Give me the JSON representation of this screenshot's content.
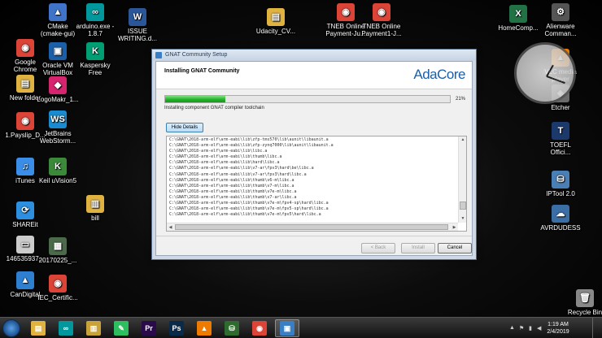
{
  "desktop": {
    "icons": [
      {
        "label": "Google\nChrome",
        "glyph": "◉",
        "color": "#db4437"
      },
      {
        "label": "New folder",
        "glyph": "▤",
        "color": "#e0b341"
      },
      {
        "label": "1.Payslip_D...",
        "glyph": "◉",
        "color": "#db4437"
      },
      {
        "label": "iTunes",
        "glyph": "♫",
        "color": "#3b8ee8"
      },
      {
        "label": "SHAREit",
        "glyph": "⟳",
        "color": "#2d8fe0"
      },
      {
        "label": "146535937...",
        "glyph": "▭",
        "color": "#cccccc"
      },
      {
        "label": "CanDigital",
        "glyph": "▲",
        "color": "#2f7fd0"
      },
      {
        "label": "CMake\n(cmake-gui)",
        "glyph": "▲",
        "color": "#3f74c9"
      },
      {
        "label": "Oracle VM\nVirtualBox",
        "glyph": "▣",
        "color": "#1b5fa8"
      },
      {
        "label": "LogoMakr_1...",
        "glyph": "◆",
        "color": "#d6246e"
      },
      {
        "label": "JetBrains\nWebStorm...",
        "glyph": "WS",
        "color": "#1a8bd0"
      },
      {
        "label": "Keil uVision5",
        "glyph": "K",
        "color": "#3a8a3a"
      },
      {
        "label": "20170225_...",
        "glyph": "▦",
        "color": "#4a6a4a"
      },
      {
        "label": "IEC_Certific...",
        "glyph": "◉",
        "color": "#db4437"
      },
      {
        "label": "arduino.exe -\n1.8.7",
        "glyph": "∞",
        "color": "#00979d"
      },
      {
        "label": "Kaspersky\nFree",
        "glyph": "K",
        "color": "#009e73"
      },
      {
        "label": "bill",
        "glyph": "▥",
        "color": "#e0b341"
      },
      {
        "label": "ISSUE\nWRITING.d...",
        "glyph": "W",
        "color": "#2b579a"
      },
      {
        "label": "Udacity_CV...",
        "glyph": "▤",
        "color": "#e0b341"
      },
      {
        "label": "TNEB Online\nPayment-Ju...",
        "glyph": "◉",
        "color": "#db4437"
      },
      {
        "label": "TNEB Online\nPayment1-J...",
        "glyph": "◉",
        "color": "#db4437"
      },
      {
        "label": "HomeComp...",
        "glyph": "X",
        "color": "#217346"
      },
      {
        "label": "Alienware\nComman...",
        "glyph": "⚙",
        "color": "#555555"
      },
      {
        "label": "VLC media\nplayer",
        "glyph": "▲",
        "color": "#ee7b00"
      },
      {
        "label": "Etcher",
        "glyph": "◈",
        "color": "#6a6a6a"
      },
      {
        "label": "TOEFL\nOffici...",
        "glyph": "T",
        "color": "#1b3a6b"
      },
      {
        "label": "IPTool 2.0",
        "glyph": "⛁",
        "color": "#4a7fb5"
      },
      {
        "label": "AVRDUDESS",
        "glyph": "☁",
        "color": "#3a6ea5"
      },
      {
        "label": "Recycle Bin",
        "glyph": "🗑",
        "color": "#888888"
      }
    ]
  },
  "installer": {
    "window_title": "GNAT Community Setup",
    "heading": "Installing GNAT Community",
    "logo": "AdaCore",
    "progress_percent": 21,
    "progress_label": "21%",
    "status": "Installing component GNAT compiler toolchain",
    "hide_details_label": "Hide Details",
    "log_lines": [
      "C:\\GNAT\\2018-arm-elf\\arm-eabi\\lib\\zfp-tms570\\lib\\aunit\\libaunit.a",
      "C:\\GNAT\\2018-arm-elf\\arm-eabi\\lib\\zfp-zynq7000\\lib\\aunit\\libaunit.a",
      "C:\\GNAT\\2018-arm-elf\\arm-eabi\\lib\\libc.a",
      "C:\\GNAT\\2018-arm-elf\\arm-eabi\\lib\\thumb\\libc.a",
      "C:\\GNAT\\2018-arm-elf\\arm-eabi\\lib\\hard\\libc.a",
      "C:\\GNAT\\2018-arm-elf\\arm-eabi\\lib\\v7-ar\\fpv3\\hard\\be\\libc.a",
      "C:\\GNAT\\2018-arm-elf\\arm-eabi\\lib\\v7-ar\\fpv3\\hard\\libc.a",
      "C:\\GNAT\\2018-arm-elf\\arm-eabi\\lib\\thumb\\v6-m\\libc.a",
      "C:\\GNAT\\2018-arm-elf\\arm-eabi\\lib\\thumb\\v7-m\\libc.a",
      "C:\\GNAT\\2018-arm-elf\\arm-eabi\\lib\\thumb\\v7e-m\\libc.a",
      "C:\\GNAT\\2018-arm-elf\\arm-eabi\\lib\\thumb\\v7-ar\\libc.a",
      "C:\\GNAT\\2018-arm-elf\\arm-eabi\\lib\\thumb\\v7e-m\\fpv4-sp\\hard\\libc.a",
      "C:\\GNAT\\2018-arm-elf\\arm-eabi\\lib\\thumb\\v7e-m\\fpv5-sp\\hard\\libc.a",
      "C:\\GNAT\\2018-arm-elf\\arm-eabi\\lib\\thumb\\v7e-m\\fpv5\\hard\\libc.a"
    ],
    "buttons": {
      "back": "< Back",
      "install": "Install",
      "cancel": "Cancel"
    }
  },
  "taskbar": {
    "apps": [
      {
        "name": "explorer",
        "glyph": "▤",
        "color": "#e0b341"
      },
      {
        "name": "arduino",
        "glyph": "∞",
        "color": "#00979d"
      },
      {
        "name": "folder",
        "glyph": "▥",
        "color": "#c9a23a"
      },
      {
        "name": "evernote",
        "glyph": "✎",
        "color": "#2dbe60"
      },
      {
        "name": "premiere",
        "glyph": "Pr",
        "color": "#2a0a4a"
      },
      {
        "name": "photoshop",
        "glyph": "Ps",
        "color": "#0a2a4a"
      },
      {
        "name": "vlc",
        "glyph": "▲",
        "color": "#ee7b00"
      },
      {
        "name": "network",
        "glyph": "⛁",
        "color": "#2e6b2e"
      },
      {
        "name": "chrome",
        "glyph": "◉",
        "color": "#db4437"
      },
      {
        "name": "gnat-setup",
        "glyph": "▣",
        "color": "#3a7fc4"
      }
    ],
    "time": "1:19 AM",
    "date": "2/4/2019"
  }
}
